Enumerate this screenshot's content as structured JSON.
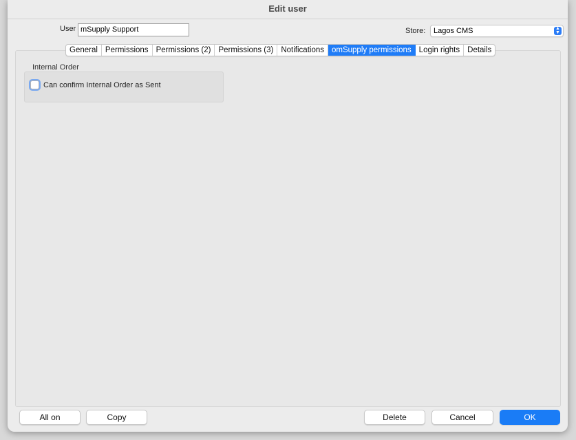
{
  "window": {
    "title": "Edit user"
  },
  "user": {
    "label": "User",
    "value": "mSupply Support"
  },
  "store": {
    "label": "Store:",
    "value": "Lagos CMS"
  },
  "tabs": [
    {
      "label": "General"
    },
    {
      "label": "Permissions"
    },
    {
      "label": "Permissions (2)"
    },
    {
      "label": "Permissions (3)"
    },
    {
      "label": "Notifications"
    },
    {
      "label": "omSupply permissions",
      "active": true
    },
    {
      "label": "Login rights"
    },
    {
      "label": "Details"
    }
  ],
  "group": {
    "title": "Internal Order",
    "checkbox": {
      "label": "Can confirm Internal Order as Sent",
      "checked": false
    }
  },
  "buttons": {
    "all_on": "All on",
    "copy": "Copy",
    "delete": "Delete",
    "cancel": "Cancel",
    "ok": "OK"
  },
  "colors": {
    "accent": "#1f7cf7"
  }
}
